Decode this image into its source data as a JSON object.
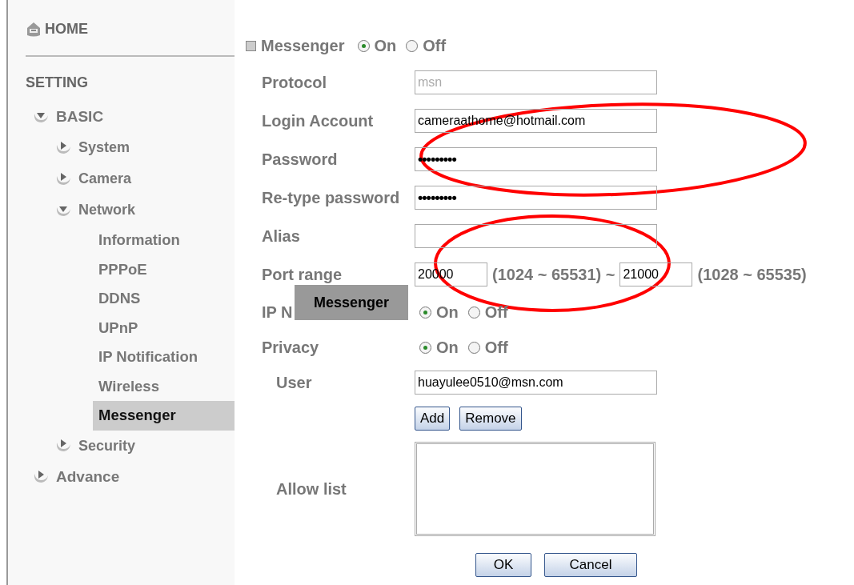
{
  "sidebar": {
    "home": "HOME",
    "section": "SETTING",
    "items": [
      {
        "label": "BASIC",
        "expanded": true,
        "children": [
          {
            "label": "System",
            "expanded": false
          },
          {
            "label": "Camera",
            "expanded": false
          },
          {
            "label": "Network",
            "expanded": true,
            "children": [
              {
                "label": "Information",
                "selected": false
              },
              {
                "label": "PPPoE",
                "selected": false
              },
              {
                "label": "DDNS",
                "selected": false
              },
              {
                "label": "UPnP",
                "selected": false
              },
              {
                "label": "IP Notification",
                "selected": false
              },
              {
                "label": "Wireless",
                "selected": false
              },
              {
                "label": "Messenger",
                "selected": true
              }
            ]
          },
          {
            "label": "Security",
            "expanded": false
          }
        ]
      },
      {
        "label": "Advance",
        "expanded": false
      }
    ]
  },
  "form": {
    "title": "Messenger",
    "options": [
      {
        "label": "On",
        "selected": true
      },
      {
        "label": "Off",
        "selected": false
      }
    ],
    "rows": [
      {
        "kind": "text",
        "label": "Protocol",
        "value": "msn",
        "disabled": true
      },
      {
        "kind": "text",
        "label": "Login Account",
        "value": "cameraathome@hotmail.com"
      },
      {
        "kind": "password",
        "label": "Password",
        "value": "•••••••••"
      },
      {
        "kind": "password",
        "label": "Re-type password",
        "value": "•••••••••"
      },
      {
        "kind": "text",
        "label": "Alias"
      },
      {
        "kind": "range",
        "label": "Port range",
        "from": "20000",
        "from_hint": "(1024 ~ 65531) ~",
        "to": "21000",
        "to_hint": "(1028 ~ 65535)"
      },
      {
        "kind": "radio",
        "label": "IP N",
        "options": [
          {
            "label": "On",
            "selected": true
          },
          {
            "label": "Off",
            "selected": false
          }
        ]
      },
      {
        "kind": "radio",
        "label": "Privacy",
        "options": [
          {
            "label": "On",
            "selected": true
          },
          {
            "label": "Off",
            "selected": false
          }
        ]
      }
    ],
    "user": {
      "label": "User",
      "value": "huayulee0510@msn.com"
    },
    "list_buttons": [
      "Add",
      "Remove"
    ],
    "allow_list": {
      "label": "Allow list"
    },
    "buttons": [
      "OK",
      "Cancel"
    ]
  },
  "tooltip": {
    "text": "Messenger"
  }
}
